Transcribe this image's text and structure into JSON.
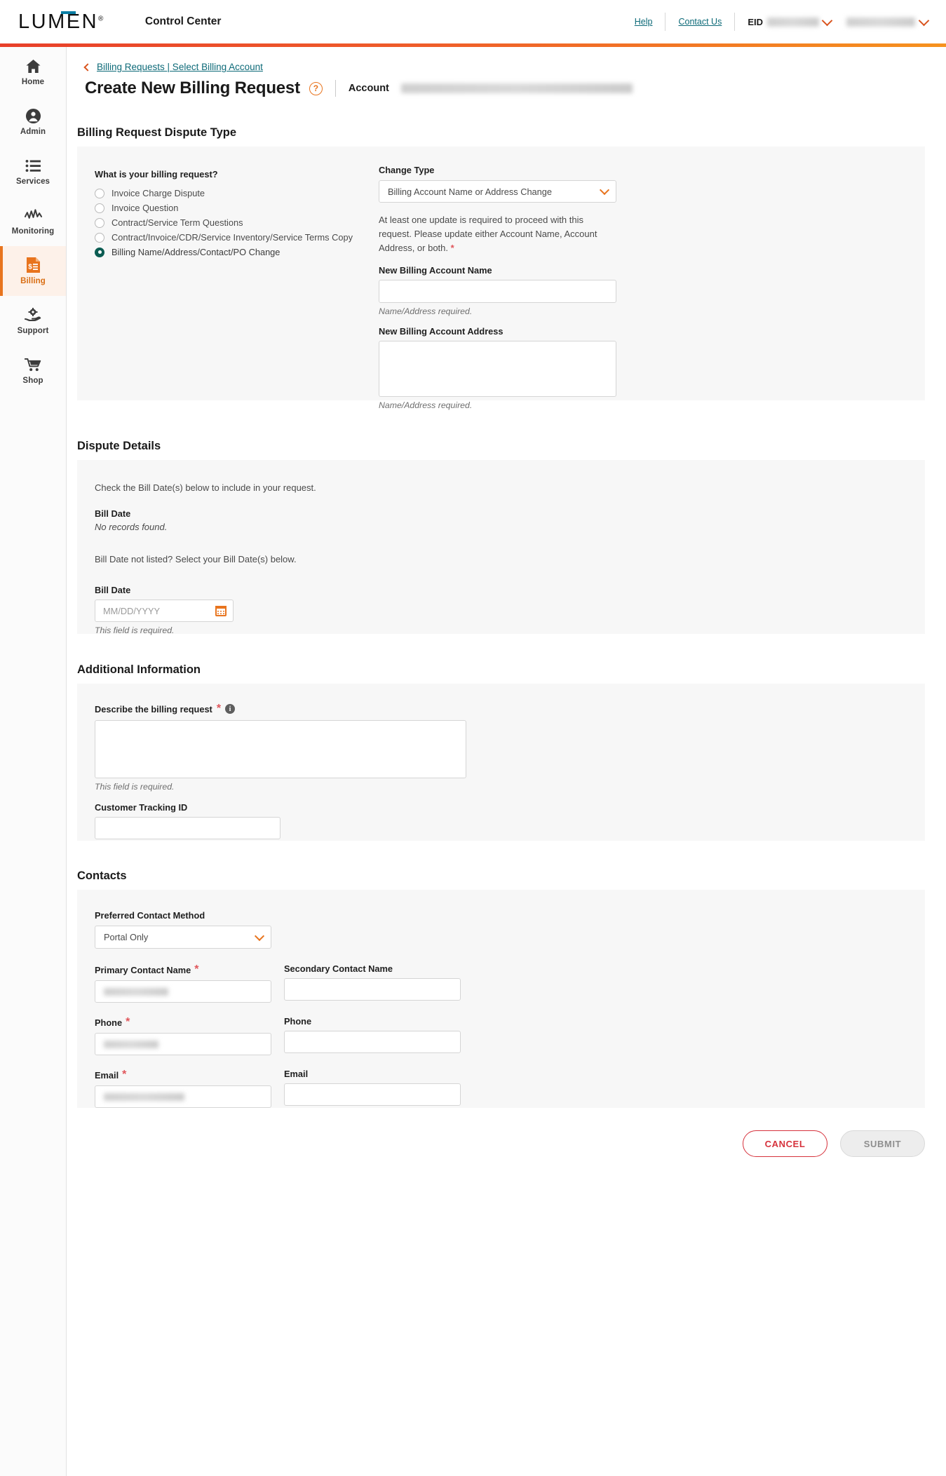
{
  "header": {
    "logo": "LUMEN",
    "logo_reg": "®",
    "app_title": "Control Center",
    "help": "Help",
    "contact_us": "Contact Us",
    "eid_label": "EID",
    "eid_value": "",
    "account_selector_value": ""
  },
  "sidebar": {
    "items": [
      {
        "label": "Home",
        "icon": "home-icon",
        "active": false
      },
      {
        "label": "Admin",
        "icon": "user-circle-icon",
        "active": false
      },
      {
        "label": "Services",
        "icon": "list-icon",
        "active": false
      },
      {
        "label": "Monitoring",
        "icon": "waveform-icon",
        "active": false
      },
      {
        "label": "Billing",
        "icon": "invoice-dollar-icon",
        "active": true
      },
      {
        "label": "Support",
        "icon": "gear-hand-icon",
        "active": false
      },
      {
        "label": "Shop",
        "icon": "cart-icon",
        "active": false
      }
    ]
  },
  "breadcrumb": {
    "text": "Billing Requests | Select Billing Account"
  },
  "page": {
    "title": "Create New Billing Request",
    "help_glyph": "?",
    "account_label": "Account",
    "account_value": ""
  },
  "dispute_type": {
    "heading": "Billing Request Dispute Type",
    "question": "What is your billing request?",
    "options": [
      {
        "label": "Invoice Charge Dispute",
        "selected": false
      },
      {
        "label": "Invoice Question",
        "selected": false
      },
      {
        "label": "Contract/Service Term Questions",
        "selected": false
      },
      {
        "label": "Contract/Invoice/CDR/Service Inventory/Service Terms Copy",
        "selected": false
      },
      {
        "label": "Billing Name/Address/Contact/PO Change",
        "selected": true
      }
    ],
    "change_type_label": "Change Type",
    "change_type_value": "Billing Account Name or Address Change",
    "notice": "At least one update is required to proceed with this request. Please update either Account Name, Account Address, or both.",
    "notice_required_mark": "*",
    "new_name_label": "New Billing Account Name",
    "new_name_value": "",
    "new_name_helper": "Name/Address required.",
    "new_address_label": "New Billing Account Address",
    "new_address_value": "",
    "new_address_helper": "Name/Address required."
  },
  "dispute_details": {
    "heading": "Dispute Details",
    "check_text": "Check the Bill Date(s) below to include in your request.",
    "bill_date_header": "Bill Date",
    "no_records": "No records found.",
    "not_listed_text": "Bill Date not listed? Select your Bill Date(s) below.",
    "bill_date_label": "Bill Date",
    "bill_date_placeholder": "MM/DD/YYYY",
    "bill_date_value": "",
    "bill_date_helper": "This field is required."
  },
  "additional_info": {
    "heading": "Additional Information",
    "describe_label": "Describe the billing request",
    "describe_required_mark": "*",
    "describe_info_glyph": "i",
    "describe_value": "",
    "describe_helper": "This field is required.",
    "tracking_label": "Customer Tracking ID",
    "tracking_value": ""
  },
  "contacts": {
    "heading": "Contacts",
    "method_label": "Preferred Contact Method",
    "method_value": "Portal Only",
    "primary_name_label": "Primary Contact Name",
    "primary_name_required": "*",
    "primary_name_value": "",
    "secondary_name_label": "Secondary Contact Name",
    "secondary_name_value": "",
    "primary_phone_label": "Phone",
    "primary_phone_required": "*",
    "primary_phone_value": "",
    "secondary_phone_label": "Phone",
    "secondary_phone_value": "",
    "primary_email_label": "Email",
    "primary_email_required": "*",
    "primary_email_value": "",
    "secondary_email_label": "Email",
    "secondary_email_value": ""
  },
  "footer": {
    "cancel_label": "CANCEL",
    "submit_label": "SUBMIT"
  },
  "colors": {
    "accent_orange": "#e8741e",
    "link_teal": "#0d6a78",
    "radio_selected": "#0b5c52",
    "required_red": "#e0565b",
    "cancel_red": "#d6323c",
    "panel_bg": "#f7f7f7"
  }
}
